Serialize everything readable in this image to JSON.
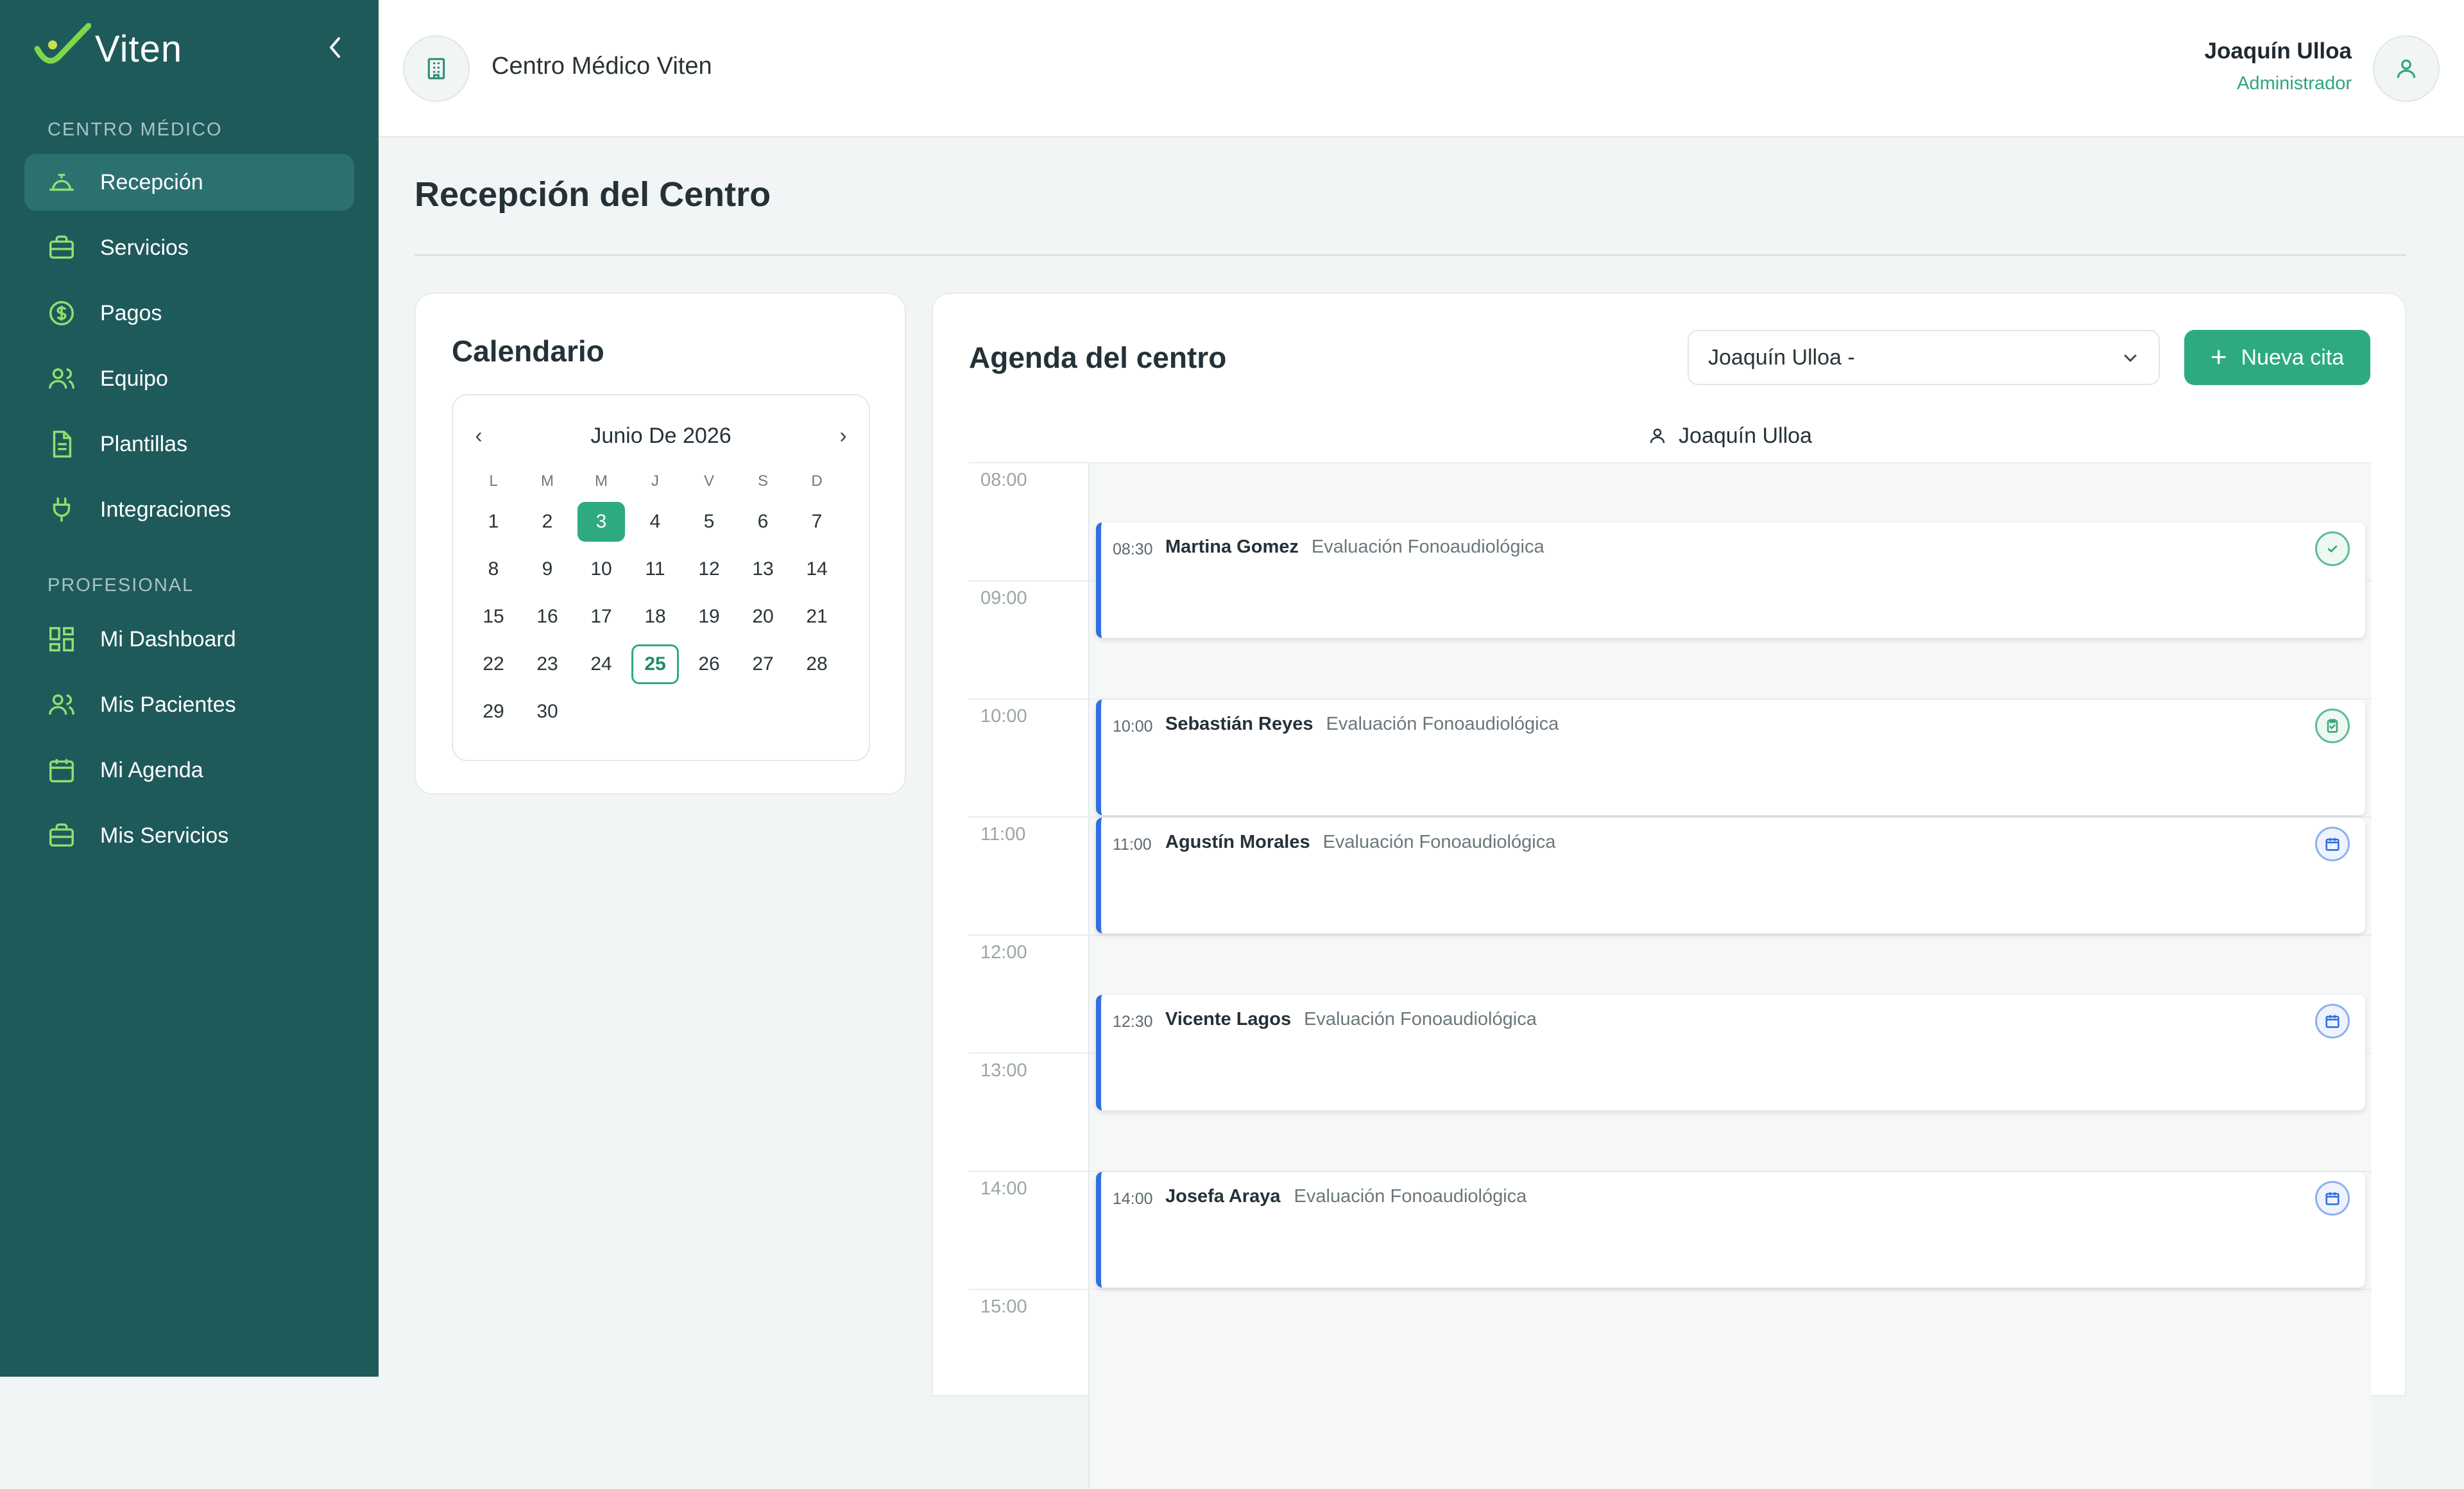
{
  "sidebar": {
    "brand": "Viten",
    "sections": [
      {
        "label": "CENTRO MÉDICO",
        "items": [
          {
            "label": "Recepción",
            "icon": "reception-bell-icon",
            "active": true
          },
          {
            "label": "Servicios",
            "icon": "briefcase-icon"
          },
          {
            "label": "Pagos",
            "icon": "dollar-circle-icon"
          },
          {
            "label": "Equipo",
            "icon": "users-icon"
          },
          {
            "label": "Plantillas",
            "icon": "document-icon"
          },
          {
            "label": "Integraciones",
            "icon": "plug-icon"
          }
        ]
      },
      {
        "label": "PROFESIONAL",
        "items": [
          {
            "label": "Mi Dashboard",
            "icon": "dashboard-grid-icon"
          },
          {
            "label": "Mis Pacientes",
            "icon": "users-icon"
          },
          {
            "label": "Mi Agenda",
            "icon": "calendar-icon"
          },
          {
            "label": "Mis Servicios",
            "icon": "briefcase-icon"
          }
        ]
      }
    ]
  },
  "header": {
    "center_name": "Centro Médico Viten",
    "user_name": "Joaquín Ulloa",
    "user_role": "Administrador"
  },
  "page": {
    "title": "Recepción del Centro"
  },
  "calendar": {
    "title": "Calendario",
    "month_label": "Junio De 2026",
    "prev": "‹",
    "next": "›",
    "weekdays": [
      "L",
      "M",
      "M",
      "J",
      "V",
      "S",
      "D"
    ],
    "days": [
      "1",
      "2",
      "3",
      "4",
      "5",
      "6",
      "7",
      "8",
      "9",
      "10",
      "11",
      "12",
      "13",
      "14",
      "15",
      "16",
      "17",
      "18",
      "19",
      "20",
      "21",
      "22",
      "23",
      "24",
      "25",
      "26",
      "27",
      "28",
      "29",
      "30"
    ],
    "first_weekday_index": 0,
    "selected_day": "3",
    "today": "25"
  },
  "agenda": {
    "title": "Agenda del centro",
    "professional_select": "Joaquín Ulloa -",
    "new_button": "Nueva cita",
    "column_header": "Joaquín Ulloa",
    "hours": [
      "08:00",
      "09:00",
      "10:00",
      "11:00",
      "12:00",
      "13:00",
      "14:00",
      "15:00"
    ],
    "appointments": [
      {
        "time": "08:30",
        "patient": "Martina Gomez",
        "service": "Evaluación Fonoaudiológica",
        "status_icon": "check-circle-icon",
        "status": "done"
      },
      {
        "time": "10:00",
        "patient": "Sebastián Reyes",
        "service": "Evaluación Fonoaudiológica",
        "status_icon": "clipboard-check-icon",
        "status": "confirmed"
      },
      {
        "time": "11:00",
        "patient": "Agustín Morales",
        "service": "Evaluación Fonoaudiológica",
        "status_icon": "calendar-icon",
        "status": "scheduled"
      },
      {
        "time": "12:30",
        "patient": "Vicente Lagos",
        "service": "Evaluación Fonoaudiológica",
        "status_icon": "calendar-icon",
        "status": "scheduled"
      },
      {
        "time": "14:00",
        "patient": "Josefa Araya",
        "service": "Evaluación Fonoaudiológica",
        "status_icon": "calendar-icon",
        "status": "scheduled"
      }
    ]
  },
  "colors": {
    "sidebar_bg": "#1f5a5b",
    "sidebar_active": "#2b7170",
    "accent_green": "#2eaa7f",
    "appointment_border": "#2f6fe0"
  }
}
